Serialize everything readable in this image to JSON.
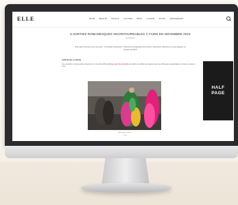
{
  "site": {
    "logo": "ELLE",
    "nav": [
      "MODE",
      "BEAUTÉ",
      "PEOPLE",
      "CULTURE",
      "DÉCO",
      "CUISINE",
      "ASTRO",
      "ABONNEMENT"
    ]
  },
  "article": {
    "title": "6 SORTIES ROMANESQUES INCONTOURNABLES À FAIRE EN NOVEMBRE 2023",
    "byline": "La rédaction",
    "lede": "Votre esprit n'est pas encore au mode ? Il est plutôt romanesque ? Découvrez le programme des sorties et expositions culturelles à ne pas manquer. La sélection de ELLE.",
    "section_heading": "SORTIE DE LA MODE",
    "body": "Une exposition incontournable à découvrir en novembre 2023",
    "body_link": "au Musée des Arts décoratifs",
    "body_rest": "qui célèbre les défilés de la saison avec des silhouettes spectaculaires en robes et couleurs vives.",
    "photo_caption": "Défilé haute couture",
    "photo_credit": "© Getty"
  },
  "ad": {
    "label": "HALF\nPAGE"
  },
  "colors": {
    "monitor_bezel": "#2b2b2d",
    "ad_background": "#1b1b1b",
    "link": "#c2185b"
  }
}
